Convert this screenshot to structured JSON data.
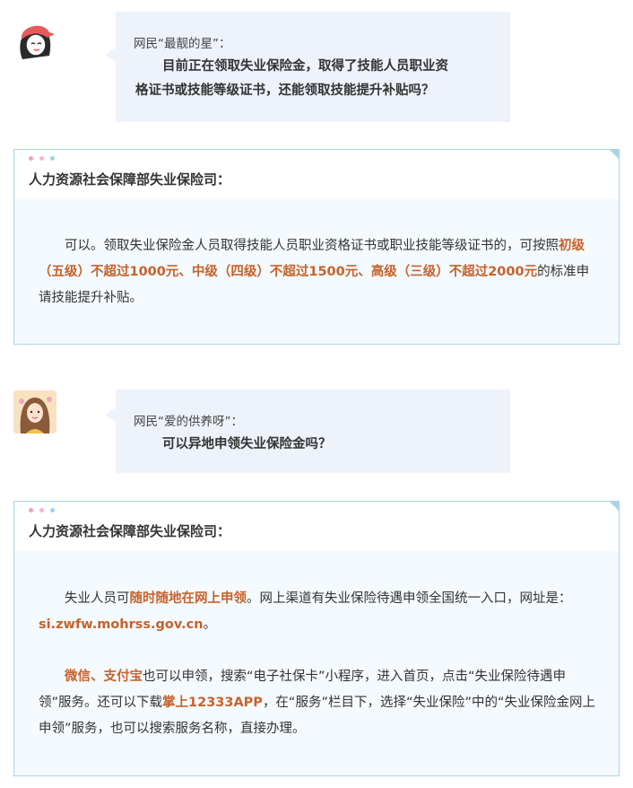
{
  "qa": [
    {
      "asker": "网民“最靓的星”：",
      "question_lines": [
        "目前正在领取失业保险金，取得了技能人员职业资",
        "格证书或技能等级证书，还能领取技能提升补贴吗？"
      ],
      "responder": "人力资源社会保障部失业保险司：",
      "answer_paragraphs": [
        [
          {
            "t": "可以。领取失业保险金人员取得技能人员职业资格证书或职业技能等级证书的，可按照",
            "hl": false
          },
          {
            "t": "初级（五级）不超过1000元、中级（四级）不超过1500元、高级（三级）不超过2000元",
            "hl": true
          },
          {
            "t": "的标准申请技能提升补贴。",
            "hl": false
          }
        ]
      ]
    },
    {
      "asker": "网民“爱的供养呀”：",
      "question_lines": [
        "可以异地申领失业保险金吗？"
      ],
      "responder": "人力资源社会保障部失业保险司：",
      "answer_paragraphs": [
        [
          {
            "t": "失业人员可",
            "hl": false
          },
          {
            "t": "随时随地在网上申领",
            "hl": true
          },
          {
            "t": "。网上渠道有失业保险待遇申领全国统一入口，网址是：",
            "hl": false
          },
          {
            "t": "si.zwfw.mohrss.gov.cn",
            "hl": true
          },
          {
            "t": "。",
            "hl": false
          }
        ],
        [
          {
            "t": "微信、支付宝",
            "hl": true
          },
          {
            "t": "也可以申领，搜索“电子社保卡”小程序，进入首页，点击“失业保险待遇申领”服务。还可以下载",
            "hl": false
          },
          {
            "t": "掌上12333APP",
            "hl": true
          },
          {
            "t": "，在“服务”栏目下，选择“失业保险”中的“失业保险金网上申领”服务，也可以搜索服务名称，直接办理。",
            "hl": false
          }
        ]
      ]
    }
  ],
  "colors": {
    "highlight": "#c7622b",
    "dot1": "#f0a0b8",
    "dot2": "#f7b6c9",
    "dot3": "#9fd0ec",
    "border": "#aad3e8",
    "bubble": "#edf2fb"
  },
  "icons": {
    "avatar1": "girl-with-cap-avatar-icon",
    "avatar2": "girl-with-flowers-avatar-icon"
  }
}
